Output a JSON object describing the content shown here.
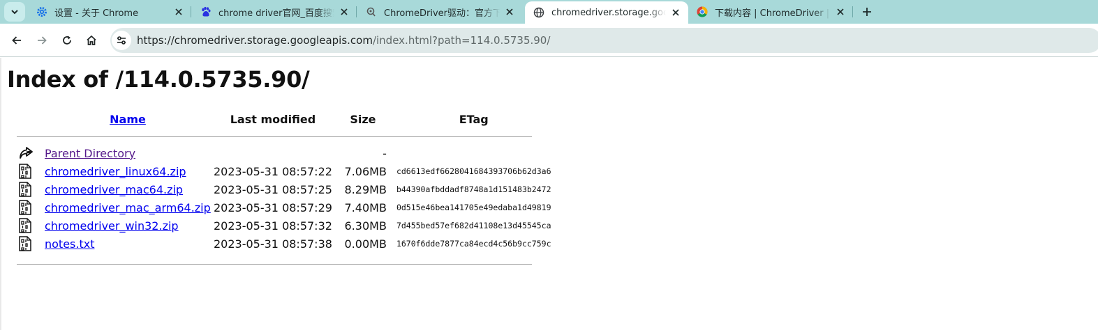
{
  "tabs": [
    {
      "title": "设置 - 关于 Chrome",
      "icon": "settings-gear-icon",
      "active": false
    },
    {
      "title": "chrome driver官网_百度搜索",
      "icon": "baidu-paw-icon",
      "active": false
    },
    {
      "title": "ChromeDriver驱动：官方下载",
      "icon": "site-pin-icon",
      "active": false
    },
    {
      "title": "chromedriver.storage.googleapis.com",
      "icon": "globe-icon",
      "active": true
    },
    {
      "title": "下载内容 | ChromeDriver | Chrome",
      "icon": "chrome-logo-icon",
      "active": false
    }
  ],
  "address_bar": {
    "url_host": "https://chromedriver.storage.googleapis.com",
    "url_path": "/index.html?path=114.0.5735.90/"
  },
  "page": {
    "heading": "Index of /114.0.5735.90/",
    "columns": {
      "name": "Name",
      "last_modified": "Last modified",
      "size": "Size",
      "etag": "ETag"
    },
    "parent": {
      "name": "Parent Directory",
      "size": "-"
    },
    "files": [
      {
        "name": "chromedriver_linux64.zip",
        "modified": "2023-05-31 08:57:22",
        "size": "7.06MB",
        "etag": "cd6613edf6628041684393706b62d3a6"
      },
      {
        "name": "chromedriver_mac64.zip",
        "modified": "2023-05-31 08:57:25",
        "size": "8.29MB",
        "etag": "b44390afbddadf8748a1d151483b2472"
      },
      {
        "name": "chromedriver_mac_arm64.zip",
        "modified": "2023-05-31 08:57:29",
        "size": "7.40MB",
        "etag": "0d515e46bea141705e49edaba1d49819"
      },
      {
        "name": "chromedriver_win32.zip",
        "modified": "2023-05-31 08:57:32",
        "size": "6.30MB",
        "etag": "7d455bed57ef682d41108e13d45545ca"
      },
      {
        "name": "notes.txt",
        "modified": "2023-05-31 08:57:38",
        "size": "0.00MB",
        "etag": "1670f6dde7877ca84ecd4c56b9cc759c"
      }
    ]
  },
  "colors": {
    "tabstrip": "#a8d9d9",
    "link": "#0000ee",
    "visited": "#551a8b"
  }
}
